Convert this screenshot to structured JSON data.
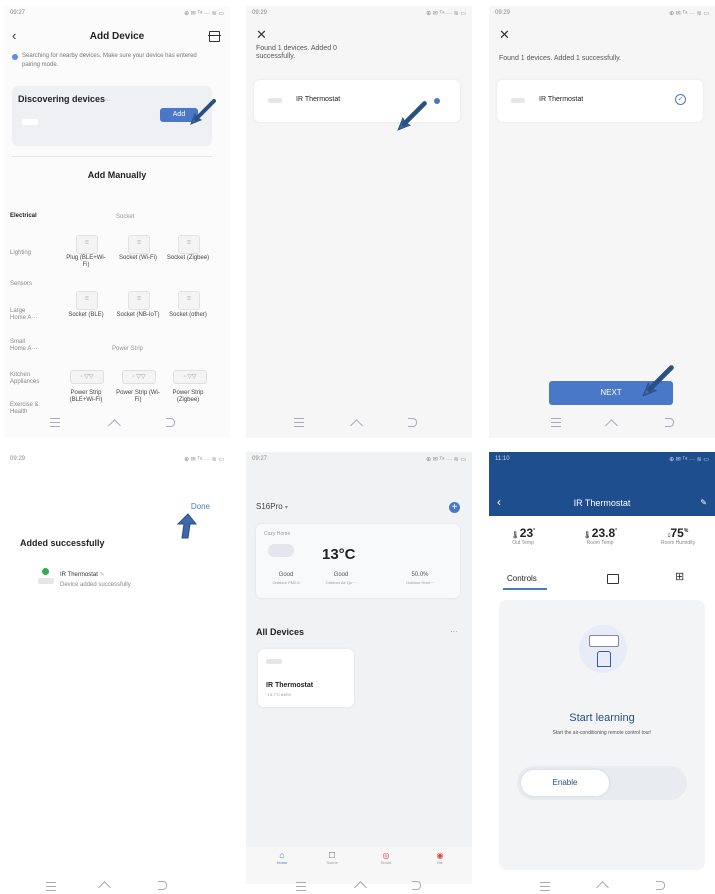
{
  "colors": {
    "accent": "#4a78c9",
    "dark_header": "#1f4e8e",
    "arrow": "#3b6aa8",
    "success": "#34a853"
  },
  "s1": {
    "time": "09:27",
    "status_right": "⊕ ✉ ᵀᵃ ··· ≋ ▭",
    "title": "Add Device",
    "hint": "Searching for nearby devices. Make sure your device has entered pairing mode.",
    "discovering": "Discovering devices",
    "discovering_suffix": "···",
    "add_btn": "Add",
    "add_manually": "Add Manually",
    "sidebar": [
      "Electrical",
      "Lighting",
      "Sensors",
      "Large Home A···",
      "Small Home A···",
      "Kitchen Appliances",
      "Exercise & Health"
    ],
    "section_socket": "Socket",
    "section_strip": "Power Strip",
    "row1": [
      "Plug (BLE+Wi-Fi)",
      "Socket (Wi-Fi)",
      "Socket (Zigbee)"
    ],
    "row2": [
      "Socket (BLE)",
      "Socket (NB-IoT)",
      "Socket (other)"
    ],
    "row3": [
      "Power Strip (BLE+Wi-Fi)",
      "Power Strip (Wi-Fi)",
      "Power Strip (Zigbee)"
    ]
  },
  "s2": {
    "time": "09:29",
    "status_right": "⊕ ✉ ᵀᵃ ··· ≋ ▭",
    "found": "Found 1 devices. Added 0 successfully.",
    "device": "IR Thermostat"
  },
  "s3": {
    "time": "09:29",
    "status_right": "⊕ ✉ ᵀᵃ ··· ≋ ▭",
    "found": "Found 1 devices. Added 1 successfully.",
    "device": "IR Thermostat",
    "next": "NEXT"
  },
  "s4": {
    "time": "09:29",
    "status_right": "⊕ ✉ ᵀᵃ ··· ≋ ▭",
    "done": "Done",
    "added": "Added successfully",
    "device": "IR Thermostat",
    "sub": "Device added successfully"
  },
  "s5": {
    "time": "09:27",
    "status_right": "⊕ ✉ ᵀᵃ ··· ≋ ▭",
    "home": "S16Pro",
    "weather_label": "Cozy Home",
    "temp": "13°C",
    "w1v": "Good",
    "w1l": "Outdoor PM2.5",
    "w2v": "Good",
    "w2l": "Outdoor Air Qu···",
    "w3v": "50.0%",
    "w3l": "Outdoor Hum···",
    "all_devices": "All Devices",
    "device": "IR Thermostat",
    "device_sub": "°15.7°C  ♦48%",
    "tabs": [
      "Home",
      "Scene",
      "Smart",
      "Me"
    ]
  },
  "s6": {
    "time": "11:10",
    "status_right": "⊕ ✉ ᵀᵃ ··· ≋ ▭",
    "title": "IR Thermostat",
    "m1v": "23",
    "m1l": "Out Temp",
    "m2v": "23.8",
    "m2l": "Room Temp",
    "m3v": "75",
    "m3l": "Room Humidity",
    "tab_controls": "Controls",
    "start_learning": "Start learning",
    "learn_desc": "Start the air-conditioning remote control tour!",
    "enable": "Enable"
  }
}
